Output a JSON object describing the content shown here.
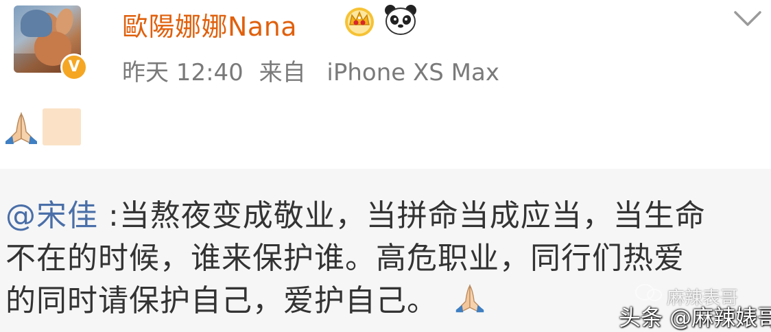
{
  "post": {
    "author_name": "歐陽娜娜Nana",
    "avatar_icon": "deer-cartoon-avatar",
    "verified_badge": "V",
    "verified_color": "#f5a623",
    "name_color": "#e0600c",
    "badge_icons": [
      "crown-icon",
      "panda-icon"
    ],
    "meta": {
      "time": "昨天 12:40",
      "source_prefix": "来自",
      "source_device": "iPhone XS Max"
    },
    "content_emojis": [
      "pray-emoji",
      "blank-emoji"
    ],
    "expand_icon": "chevron-down-icon"
  },
  "repost": {
    "mention": "@宋佳",
    "separator": " :",
    "line1": "当熬夜变成敬业，当拼命当成应当，当生命",
    "line2": "不在的时候，谁来保护谁。高危职业，同行们热爱",
    "line3": "的同时请保护自己，爱护自己。",
    "trailing_emoji": "pray-emoji",
    "mention_color": "#4a6fa8"
  },
  "watermark": {
    "faint_text": "麻辣表哥",
    "text": "头条 @麻辣婊哥"
  }
}
